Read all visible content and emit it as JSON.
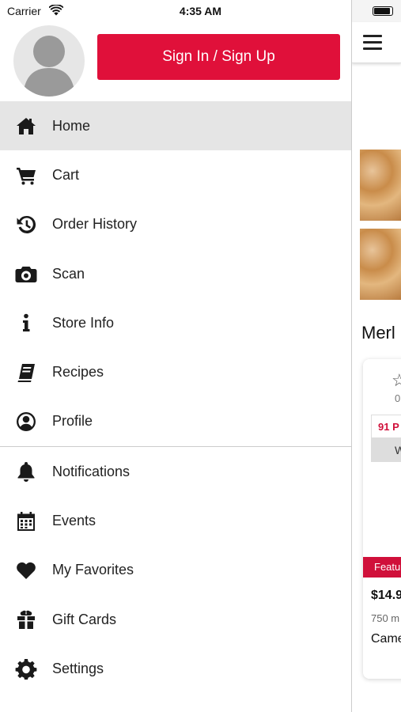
{
  "status_bar": {
    "carrier": "Carrier",
    "time": "4:35 AM"
  },
  "drawer": {
    "signin_label": "Sign In / Sign Up",
    "menu_group_1": [
      {
        "label": "Home",
        "icon": "home-icon",
        "active": true
      },
      {
        "label": "Cart",
        "icon": "cart-icon"
      },
      {
        "label": "Order History",
        "icon": "history-icon"
      },
      {
        "label": "Scan",
        "icon": "camera-icon"
      },
      {
        "label": "Store Info",
        "icon": "info-icon"
      },
      {
        "label": "Recipes",
        "icon": "book-icon"
      },
      {
        "label": "Profile",
        "icon": "user-circle-icon"
      }
    ],
    "menu_group_2": [
      {
        "label": "Notifications",
        "icon": "bell-icon"
      },
      {
        "label": "Events",
        "icon": "calendar-icon"
      },
      {
        "label": "My Favorites",
        "icon": "heart-icon"
      },
      {
        "label": "Gift Cards",
        "icon": "gift-icon"
      },
      {
        "label": "Settings",
        "icon": "gear-icon"
      }
    ]
  },
  "background": {
    "section_title": "Merl",
    "card": {
      "rating_count": "0",
      "points": "91 P",
      "button_label": "W",
      "featured": "Featu",
      "price": "$14.9",
      "size": "750 m",
      "name": "Came"
    }
  },
  "colors": {
    "accent": "#e0103a",
    "active_bg": "#e5e5e5"
  }
}
